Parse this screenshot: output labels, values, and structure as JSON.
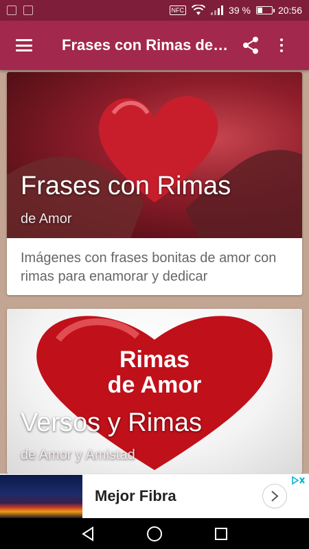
{
  "status_bar": {
    "nfc_label": "NFC",
    "battery_text": "39 %",
    "time": "20:56",
    "battery_level": 0.39
  },
  "app_bar": {
    "title": "Frases con Rimas de Amor",
    "color": "#a3284d"
  },
  "cards": [
    {
      "title": "Frases con Rimas",
      "subtitle": "de Amor",
      "description": "Imágenes con frases bonitas de amor con rimas para enamorar y dedicar",
      "image_icon": "heart-in-hands-image"
    },
    {
      "title": "Versos y Rimas",
      "subtitle": "de Amor y Amistad",
      "image_text": "Rimas de Amor",
      "image_icon": "red-heart-image"
    }
  ],
  "ad": {
    "headline": "Mejor Fibra",
    "cta_icon": "chevron-right-icon",
    "choices_icon": "ad-choices-icon"
  },
  "nav_bar": {
    "back_icon": "back-triangle-icon",
    "home_icon": "home-circle-icon",
    "recents_icon": "recents-square-icon"
  }
}
